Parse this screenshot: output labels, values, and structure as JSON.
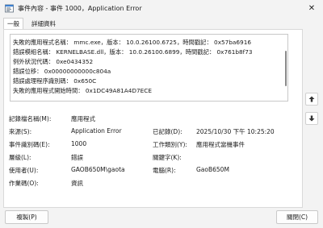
{
  "window": {
    "title": "事件內容 - 事件 1000，Application Error",
    "close_symbol": "✕"
  },
  "tabs": [
    {
      "label": "一般"
    },
    {
      "label": "詳細資料"
    }
  ],
  "description": {
    "lines": [
      "失敗的應用程式名稱： mmc.exe，版本： 10.0.26100.6725，時間戳記： 0x57ba6916",
      "錯誤模組名稱： KERNELBASE.dll，版本： 10.0.26100.6899，時間戳記： 0x761b8f73",
      "例外狀況代碼： 0xe0434352",
      "錯誤位移： 0x00000000000c804a",
      "錯誤處理程序識別碼： 0x650C",
      "失敗的應用程式開始時間： 0x1DC49A81A4D7ECE"
    ]
  },
  "fields": {
    "log_name_label": "記錄檔名稱(M):",
    "log_name_value": "應用程式",
    "source_label": "來源(S):",
    "source_value": "Application Error",
    "logged_label": "已記錄(D):",
    "logged_value": "2025/10/30 下午 10:25:20",
    "event_id_label": "事件識別碼(E):",
    "event_id_value": "1000",
    "task_label": "工作類別(Y):",
    "task_value": "應用程式當機事件",
    "level_label": "層級(L):",
    "level_value": "錯誤",
    "keywords_label": "關鍵字(K):",
    "keywords_value": "",
    "user_label": "使用者(U):",
    "user_value": "GAOB650M\\gaota",
    "computer_label": "電腦(R):",
    "computer_value": "GaoB650M",
    "opcode_label": "作業碼(O):",
    "opcode_value": "資訊"
  },
  "buttons": {
    "copy": "複製(P)",
    "close": "關閉(C)"
  },
  "icons": {
    "app": "event-viewer-icon",
    "up": "arrow-up-icon",
    "down": "arrow-down-icon"
  }
}
